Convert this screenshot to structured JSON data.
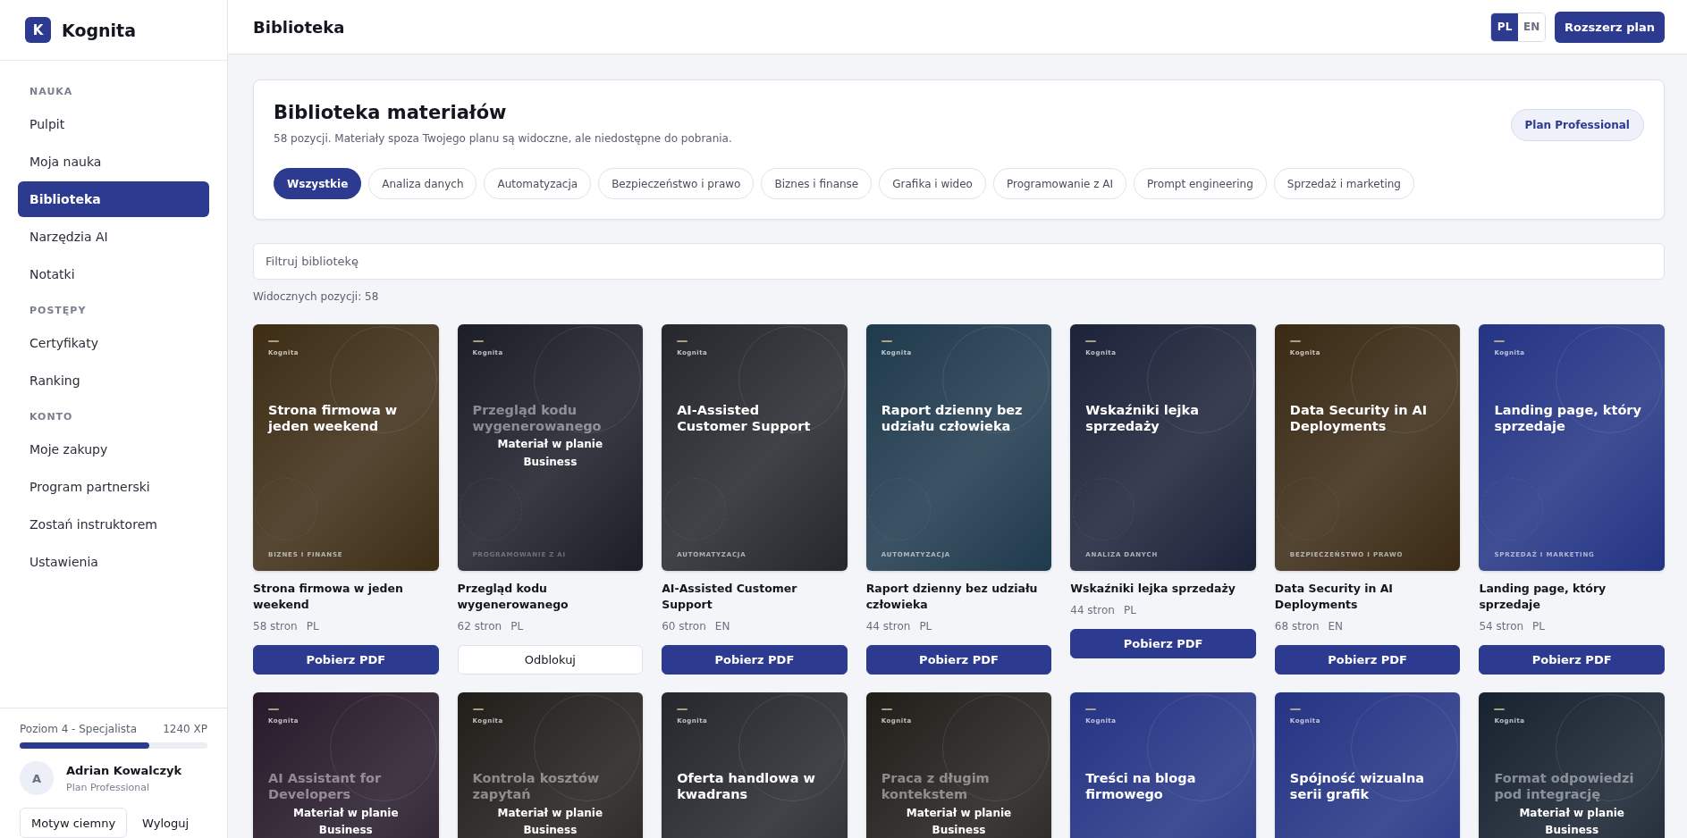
{
  "brand": {
    "logo_letter": "K",
    "name": "Kognita"
  },
  "sidebar": {
    "sections": [
      {
        "label": "NAUKA",
        "items": [
          {
            "label": "Pulpit",
            "selected": false
          },
          {
            "label": "Moja nauka",
            "selected": false
          },
          {
            "label": "Biblioteka",
            "selected": true
          },
          {
            "label": "Narzędzia AI",
            "selected": false
          },
          {
            "label": "Notatki",
            "selected": false
          }
        ]
      },
      {
        "label": "POSTĘPY",
        "items": [
          {
            "label": "Certyfikaty",
            "selected": false
          },
          {
            "label": "Ranking",
            "selected": false
          }
        ]
      },
      {
        "label": "KONTO",
        "items": [
          {
            "label": "Moje zakupy",
            "selected": false
          },
          {
            "label": "Program partnerski",
            "selected": false
          },
          {
            "label": "Zostań instruktorem",
            "selected": false
          },
          {
            "label": "Ustawienia",
            "selected": false
          }
        ]
      }
    ],
    "footer": {
      "level_label": "Poziom 4 - Specjalista",
      "xp": "1240 XP",
      "level": 0.69,
      "avatar_letter": "A",
      "user_name": "Adrian Kowalczyk",
      "plan": "Plan Professional",
      "buttons": [
        {
          "label": "Motyw ciemny",
          "kind": "outline"
        },
        {
          "label": "Wyloguj",
          "kind": "plain"
        }
      ]
    }
  },
  "header": {
    "title": "Biblioteka",
    "languages": [
      {
        "label": "PL",
        "selected": true
      },
      {
        "label": "EN",
        "selected": false
      }
    ],
    "upgrade_button": "Rozszerz plan"
  },
  "panel": {
    "title": "Biblioteka materiałów",
    "subtitle": "58 pozycji. Materiały spoza Twojego planu są widoczne, ale niedostępne do pobrania.",
    "plan_badge": "Plan Professional",
    "filters": [
      {
        "label": "Wszystkie",
        "selected": true
      },
      {
        "label": "Analiza danych",
        "selected": false
      },
      {
        "label": "Automatyzacja",
        "selected": false
      },
      {
        "label": "Bezpieczeństwo i prawo",
        "selected": false
      },
      {
        "label": "Biznes i finanse",
        "selected": false
      },
      {
        "label": "Grafika i wideo",
        "selected": false
      },
      {
        "label": "Programowanie z AI",
        "selected": false
      },
      {
        "label": "Prompt engineering",
        "selected": false
      },
      {
        "label": "Sprzedaż i marketing",
        "selected": false
      }
    ]
  },
  "search": {
    "placeholder": "Filtruj bibliotekę"
  },
  "count": "Widocznych pozycji: 58",
  "cards": [
    {
      "brand": "Kognita",
      "cover_title": "Strona firmowa w jeden weekend",
      "category": "BIZNES I FINANSE",
      "color": "#3d2d15",
      "locked": false,
      "title": "Strona firmowa w jeden weekend",
      "pages": "58 stron",
      "lang": "PL",
      "button": "Pobierz PDF"
    },
    {
      "brand": "Kognita",
      "cover_title": "Przegląd kodu wygenerowanego",
      "category": "PROGRAMOWANIE Z AI",
      "color": "#1b1e27",
      "locked": true,
      "lock_note": "Materiał w planie Business",
      "title": "Przegląd kodu wygenerowanego",
      "pages": "62 stron",
      "lang": "PL",
      "button": "Odblokuj"
    },
    {
      "brand": "Kognita",
      "cover_title": "AI-Assisted Customer Support",
      "category": "AUTOMATYZACJA",
      "color": "#26272c",
      "locked": false,
      "title": "AI-Assisted Customer Support",
      "pages": "60 stron",
      "lang": "EN",
      "button": "Pobierz PDF"
    },
    {
      "brand": "Kognita",
      "cover_title": "Raport dzienny bez udziału człowieka",
      "category": "AUTOMATYZACJA",
      "color": "#1f3a4d",
      "locked": false,
      "title": "Raport dzienny bez udziału człowieka",
      "pages": "44 stron",
      "lang": "PL",
      "button": "Pobierz PDF"
    },
    {
      "brand": "Kognita",
      "cover_title": "Wskaźniki lejka sprzedaży",
      "category": "ANALIZA DANYCH",
      "color": "#1c2238",
      "locked": false,
      "title": "Wskaźniki lejka sprzedaży",
      "pages": "44 stron",
      "lang": "PL",
      "button": "Pobierz PDF"
    },
    {
      "brand": "Kognita",
      "cover_title": "Data Security in AI Deployments",
      "category": "BEZPIECZEŃSTWO I PRAWO",
      "color": "#3a2a14",
      "locked": false,
      "title": "Data Security in AI Deployments",
      "pages": "68 stron",
      "lang": "EN",
      "button": "Pobierz PDF"
    },
    {
      "brand": "Kognita",
      "cover_title": "Landing page, który sprzedaje",
      "category": "SPRZEDAŻ I MARKETING",
      "color": "#243484",
      "locked": false,
      "title": "Landing page, który sprzedaje",
      "pages": "54 stron",
      "lang": "PL",
      "button": "Pobierz PDF"
    },
    {
      "brand": "Kognita",
      "cover_title": "AI Assistant for Developers",
      "color": "#271a2a",
      "locked": true,
      "lock_note": "Materiał w planie Business"
    },
    {
      "brand": "Kognita",
      "cover_title": "Kontrola kosztów zapytań",
      "color": "#211e1a",
      "locked": true,
      "lock_note": "Materiał w planie Business"
    },
    {
      "brand": "Kognita",
      "cover_title": "Oferta handlowa w kwadrans",
      "color": "#26272c",
      "locked": false
    },
    {
      "brand": "Kognita",
      "cover_title": "Praca z długim kontekstem",
      "color": "#211e1a",
      "locked": true,
      "lock_note": "Materiał w planie Business"
    },
    {
      "brand": "Kognita",
      "cover_title": "Treści na bloga firmowego",
      "color": "#243484",
      "locked": false
    },
    {
      "brand": "Kognita",
      "cover_title": "Spójność wizualna serii grafik",
      "color": "#243484",
      "locked": false
    },
    {
      "brand": "Kognita",
      "cover_title": "Format odpowiedzi pod integrację",
      "color": "#17222f",
      "locked": true,
      "lock_note": "Materiał w planie Business"
    }
  ]
}
